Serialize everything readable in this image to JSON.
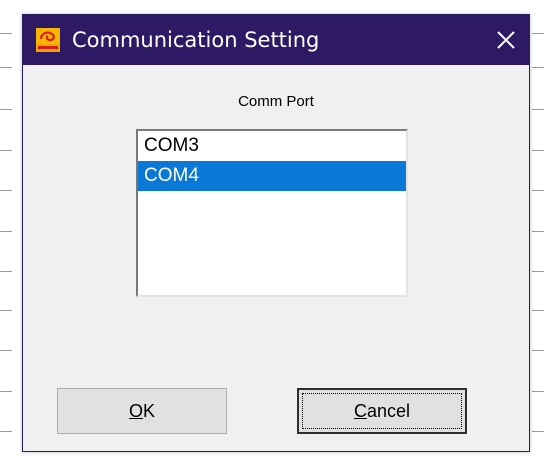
{
  "window": {
    "title": "Communication Setting",
    "app_icon": "app-logo-icon",
    "close_icon": "close-icon",
    "title_bar_color": "#2e1a64"
  },
  "comm_port": {
    "label": "Comm Port",
    "items": [
      {
        "label": "COM3",
        "selected": false
      },
      {
        "label": "COM4",
        "selected": true
      }
    ],
    "selection_color": "#0a78d6"
  },
  "buttons": {
    "ok": {
      "mnemonic": "O",
      "rest": "K"
    },
    "cancel": {
      "mnemonic": "C",
      "rest": "ancel"
    }
  }
}
